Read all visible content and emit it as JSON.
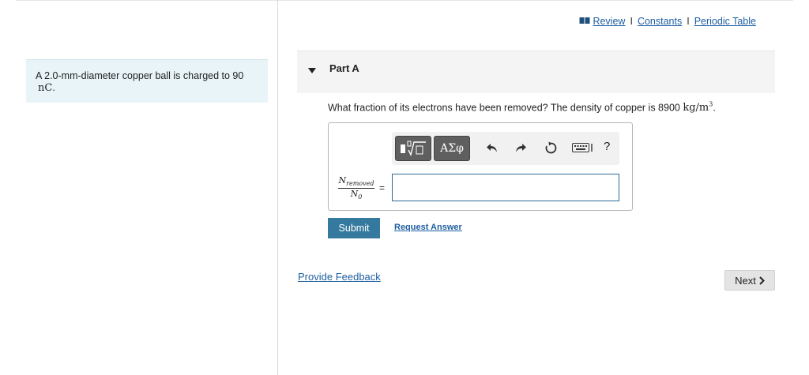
{
  "problem": {
    "text": "A 2.0-mm-diameter copper ball is charged to 90",
    "unit": "nC",
    "trailing": "."
  },
  "resources": {
    "review": "Review",
    "constants": "Constants",
    "periodic_table": "Periodic Table",
    "separator": "I"
  },
  "part": {
    "title": "Part A"
  },
  "question": {
    "text": "What fraction of its electrons have been removed? The density of copper is 8900",
    "unit_base": "kg/m",
    "unit_exp": "3",
    "trailing": "."
  },
  "toolbar": {
    "greek_label": "ΑΣφ",
    "help_label": "?"
  },
  "equation": {
    "numerator_symbol": "N",
    "numerator_sub": "removed",
    "denominator_symbol": "N",
    "denominator_sub": "0",
    "equals": "="
  },
  "answer": {
    "value": ""
  },
  "actions": {
    "submit": "Submit",
    "request_answer": "Request Answer",
    "provide_feedback": "Provide Feedback",
    "next": "Next"
  }
}
